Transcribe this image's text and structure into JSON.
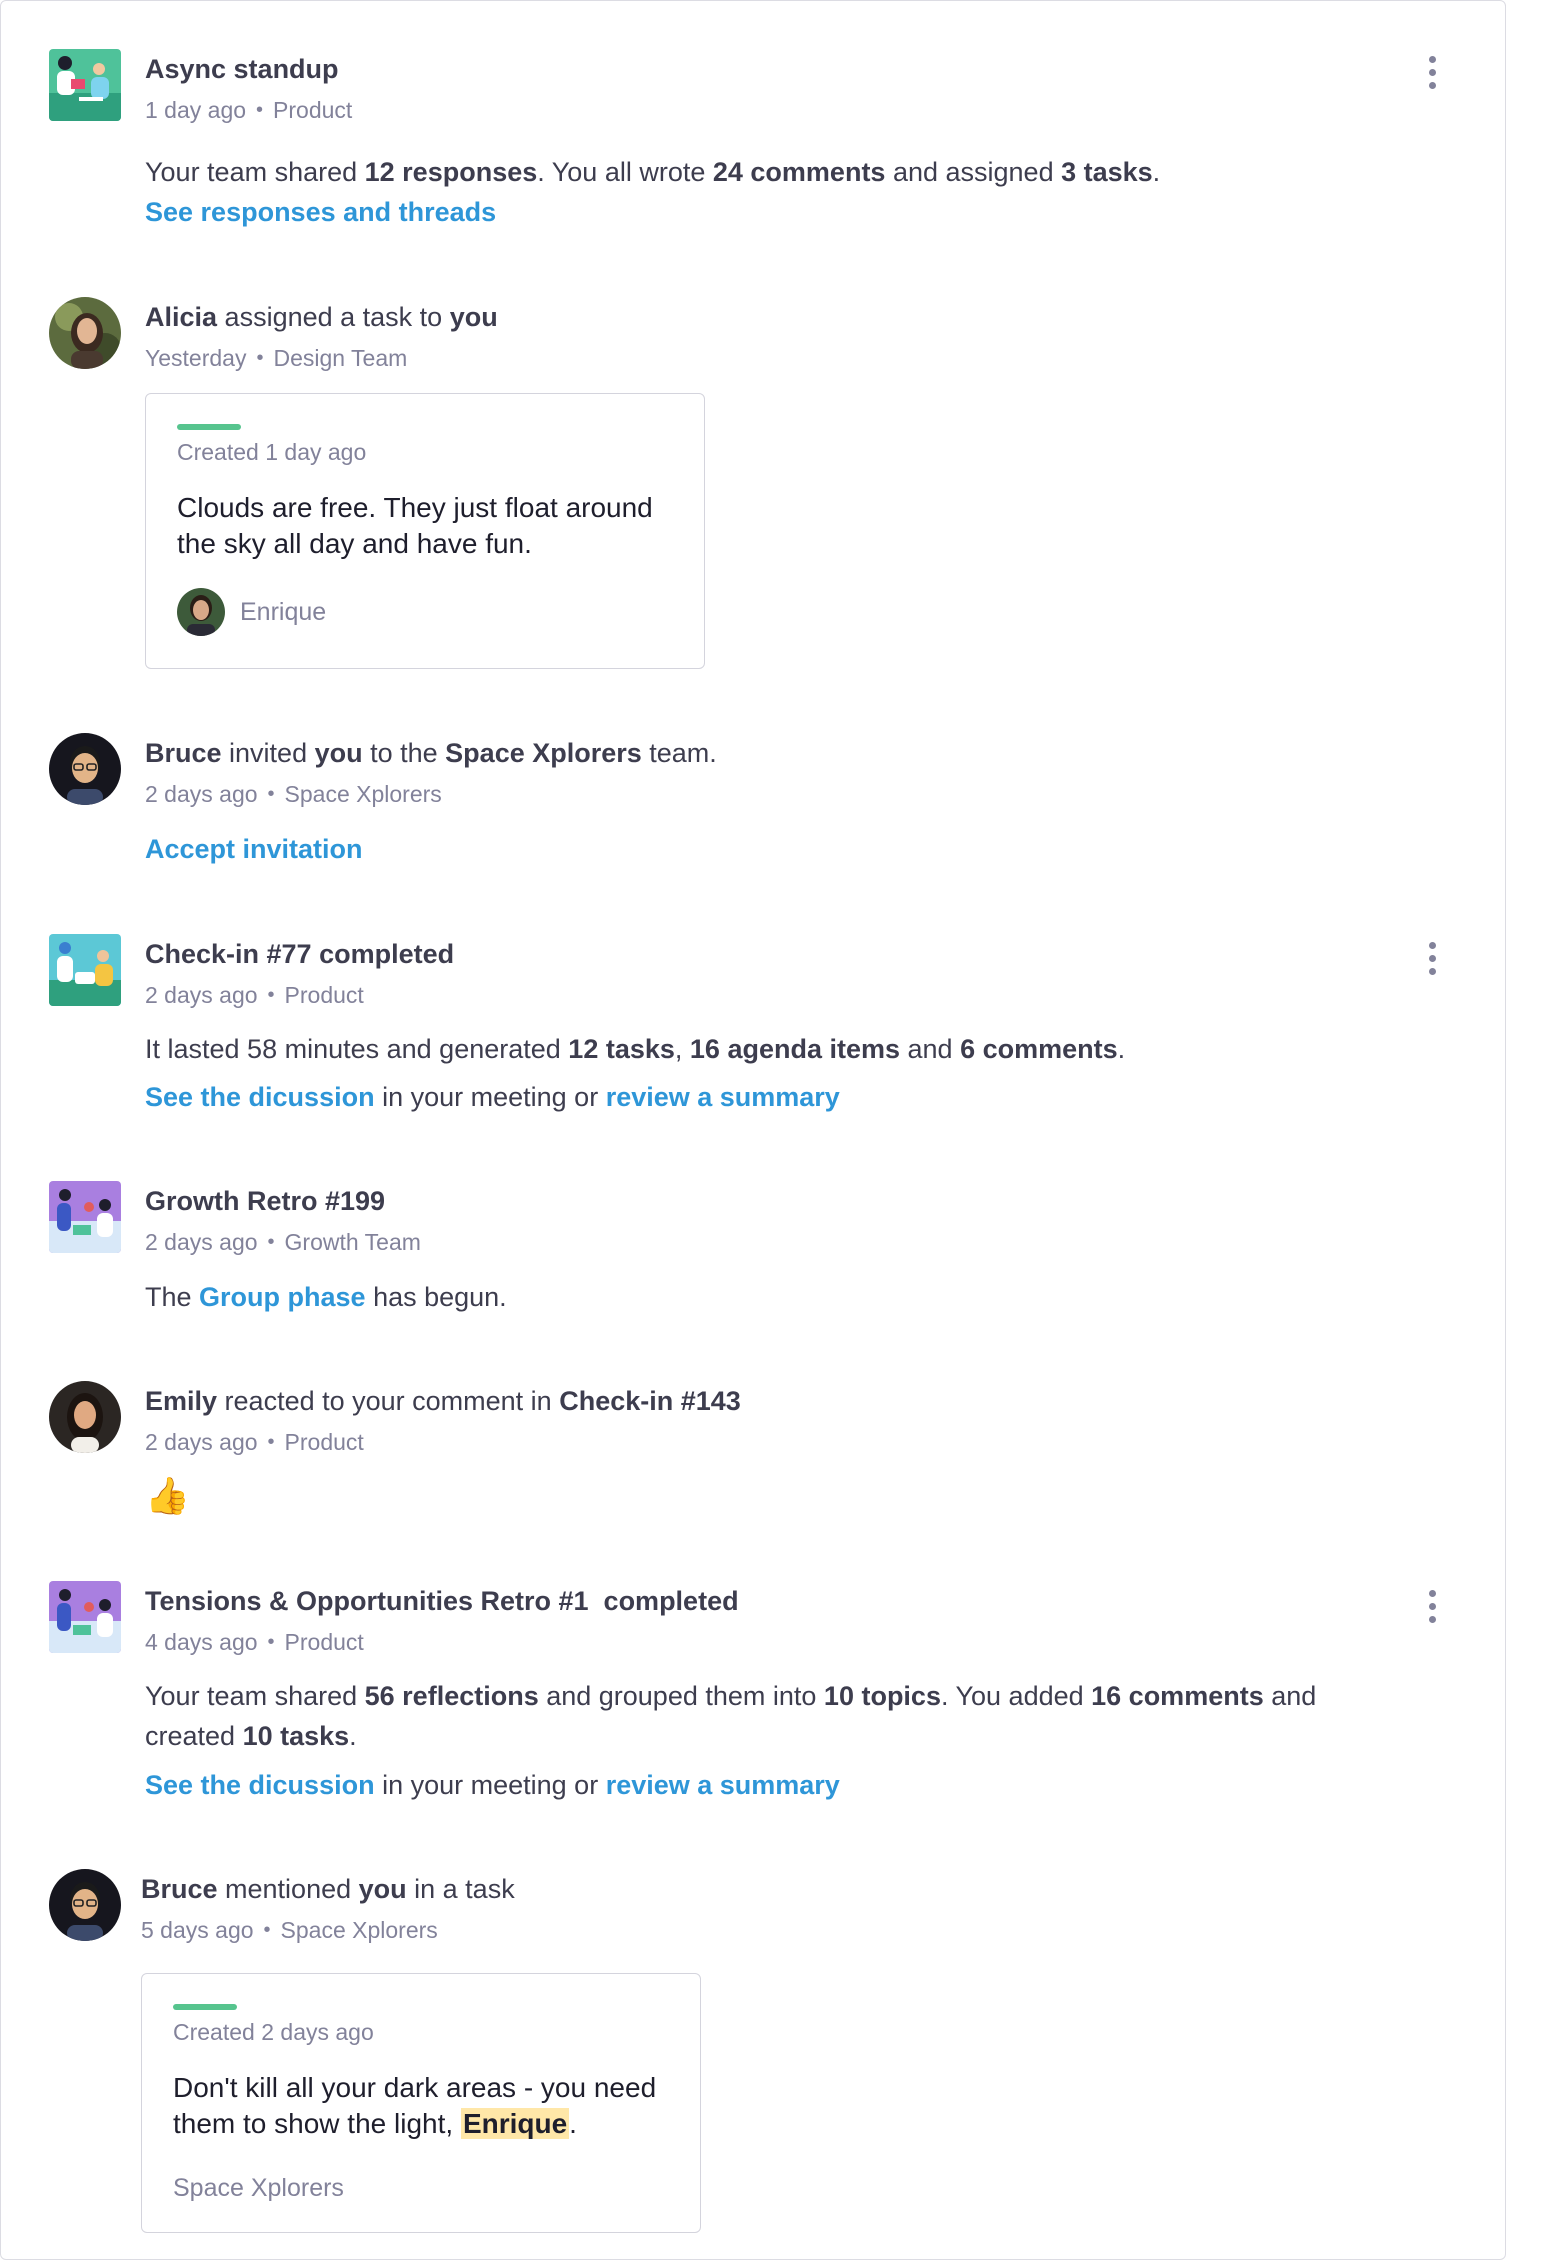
{
  "feed": {
    "async": {
      "title": "Async standup",
      "time": "1 day ago",
      "team": "Product",
      "body_1": "Your team shared ",
      "responses": "12 responses",
      "body_2": ". You all wrote ",
      "comments": "24 comments",
      "body_3": " and assigned ",
      "tasks": "3 tasks",
      "body_4": ".",
      "link": "See responses and threads"
    },
    "alicia": {
      "name": "Alicia",
      "action": " assigned a task to ",
      "target": "you",
      "time": "Yesterday",
      "team": "Design Team",
      "card_created": "Created 1 day ago",
      "card_text": "Clouds are free. They just float around the sky all day and have fun.",
      "card_author": "Enrique"
    },
    "bruce_invite": {
      "name": "Bruce",
      "action_1": " invited ",
      "you": "you",
      "action_2": " to the ",
      "team_name": "Space Xplorers",
      "action_3": " team.",
      "time": "2 days ago",
      "team": "Space Xplorers",
      "link": "Accept invitation"
    },
    "checkin77": {
      "title": "Check-in #77 completed",
      "time": "2 days ago",
      "team": "Product",
      "body_1": "It lasted 58 minutes and generated ",
      "tasks": "12 tasks",
      "sep": ", ",
      "agenda": "16 agenda items",
      "and": " and ",
      "comments": "6 comments",
      "end": ".",
      "link_1": "See the dicussion",
      "mid": " in your meeting or ",
      "link_2": "review a summary"
    },
    "growth": {
      "title": "Growth Retro #199",
      "time": "2 days ago",
      "team": "Growth Team",
      "body_1": "The ",
      "link": "Group phase",
      "body_2": " has begun."
    },
    "emily": {
      "name": "Emily",
      "action": " reacted to your comment in ",
      "target": "Check-in #143",
      "time": "2 days ago",
      "team": "Product",
      "reaction": "👍"
    },
    "tensions": {
      "title": "Tensions & Opportunities Retro #1  completed",
      "time": "4 days ago",
      "team": "Product",
      "body_1": "Your team shared ",
      "reflections": "56 reflections",
      "body_2": " and grouped them into ",
      "topics": "10 topics",
      "body_3": ". You added ",
      "comments": "16 comments",
      "body_4": " and created ",
      "tasks": "10 tasks",
      "body_5": ".",
      "link_1": "See the dicussion",
      "mid": " in your meeting or ",
      "link_2": "review a summary"
    },
    "bruce_mention": {
      "name": "Bruce",
      "action": " mentioned ",
      "you": "you",
      "action_2": " in a task",
      "time": "5 days ago",
      "team": "Space Xplorers",
      "card_created": "Created 2 days ago",
      "card_text_1": "Don't kill all your dark areas - you need them to show the light, ",
      "card_mention": "Enrique",
      "card_text_2": ".",
      "card_team": "Space Xplorers"
    }
  },
  "meta_separator": "•",
  "colors": {
    "link": "#2e96d8",
    "text": "#3d3d4e",
    "muted": "#82829a",
    "accent_green": "#56c48e",
    "mention_highlight": "#ffe7a8"
  }
}
